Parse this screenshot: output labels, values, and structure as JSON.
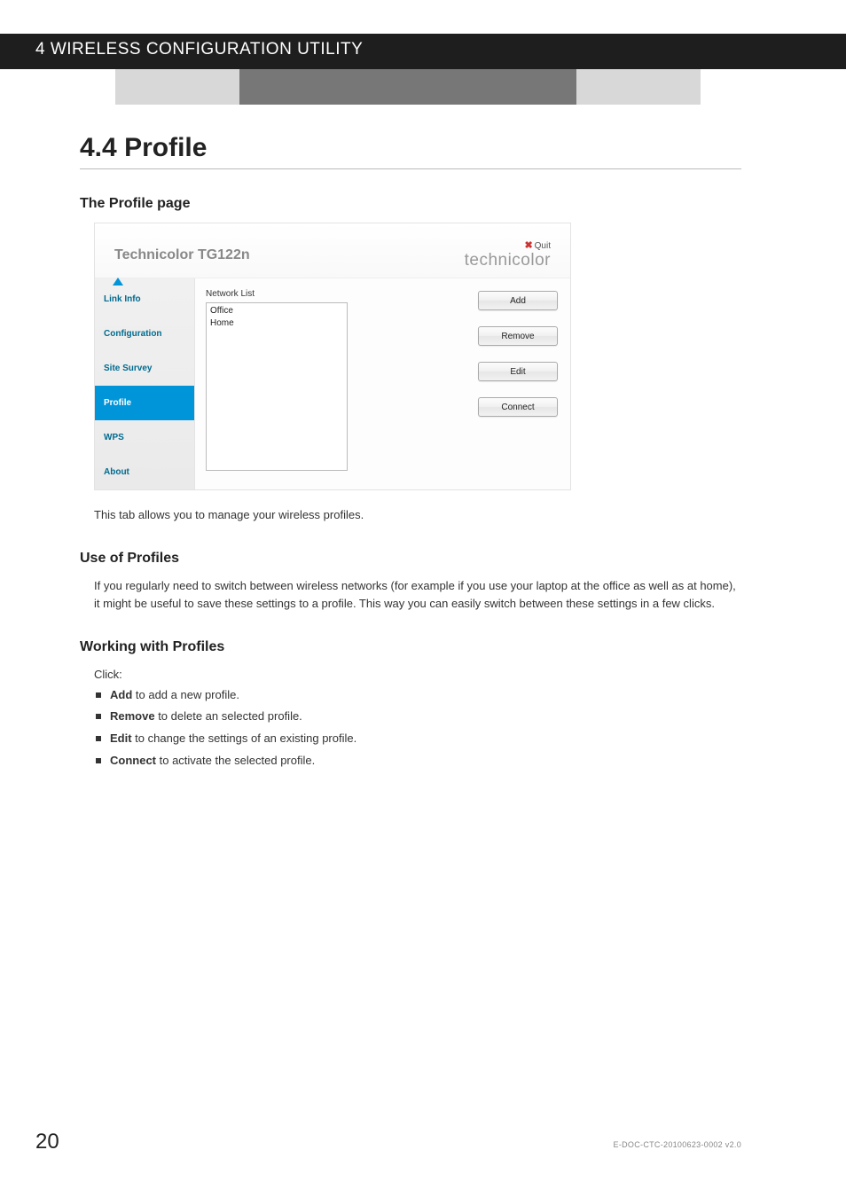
{
  "header": {
    "chapter": "4 WIRELESS CONFIGURATION UTILITY"
  },
  "section": {
    "number": "4.4",
    "title": "Profile"
  },
  "sub1": {
    "heading": "The Profile page",
    "after_text": "This tab allows you to manage your wireless profiles."
  },
  "app": {
    "title": "Technicolor TG122n",
    "quit": "Quit",
    "brand": "technicolor",
    "sidebar": {
      "items": [
        {
          "label": "Link Info"
        },
        {
          "label": "Configuration"
        },
        {
          "label": "Site Survey"
        },
        {
          "label": "Profile"
        },
        {
          "label": "WPS"
        },
        {
          "label": "About"
        }
      ]
    },
    "main": {
      "list_label": "Network List",
      "networks": [
        {
          "name": "Office"
        },
        {
          "name": "Home"
        }
      ],
      "buttons": {
        "add": "Add",
        "remove": "Remove",
        "edit": "Edit",
        "connect": "Connect"
      }
    }
  },
  "sub2": {
    "heading": "Use of Profiles",
    "text": "If you regularly need to switch between wireless networks (for example if you use your laptop at the office as well as at home), it might be useful to save these settings to a profile. This way you can easily switch between these settings in a few clicks."
  },
  "sub3": {
    "heading": "Working with Profiles",
    "intro": "Click:",
    "bullets": {
      "b0": {
        "bold": "Add",
        "rest": " to add a new profile."
      },
      "b1": {
        "bold": "Remove",
        "rest": " to delete an selected profile."
      },
      "b2": {
        "bold": "Edit",
        "rest": " to change the settings of an existing profile."
      },
      "b3": {
        "bold": "Connect",
        "rest": " to activate the selected profile."
      }
    }
  },
  "footer": {
    "page": "20",
    "docref": "E-DOC-CTC-20100623-0002 v2.0"
  }
}
